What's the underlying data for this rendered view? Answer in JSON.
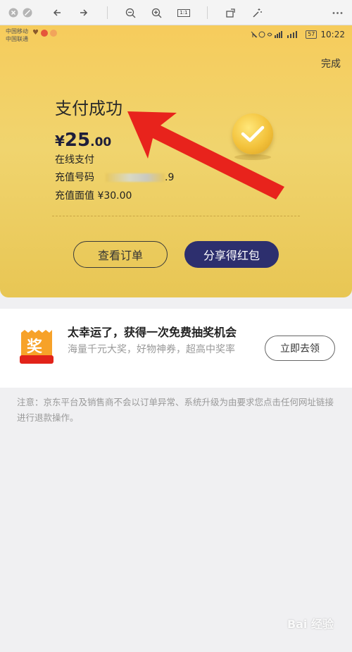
{
  "viewer": {
    "tools": [
      "close-icon",
      "stop-icon",
      "back-icon",
      "forward-icon",
      "zoom-out-icon",
      "zoom-in-icon",
      "actual-size-icon",
      "rotate-icon",
      "magic-icon",
      "more-icon"
    ],
    "actual_size_label": "1:1"
  },
  "status_bar": {
    "carrier1": "中国移动",
    "carrier2": "中国联通",
    "battery": "57",
    "time": "10:22"
  },
  "header": {
    "done_label": "完成"
  },
  "payment": {
    "title": "支付成功",
    "currency": "¥",
    "amount_int": "25",
    "amount_dec": ".00",
    "method": "在线支付",
    "recharge_number_label": "充值号码",
    "recharge_number_suffix": ".9",
    "face_value_label": "充值面值 ¥30.00"
  },
  "actions": {
    "view_order": "查看订单",
    "share": "分享得红包"
  },
  "lottery": {
    "icon_char": "奖",
    "title": "太幸运了，获得一次免费抽奖机会",
    "desc": "海量千元大奖，好物神券，超高中奖率",
    "button": "立即去领"
  },
  "notice": "注意：京东平台及销售商不会以订单异常、系统升级为由要求您点击任何网址链接进行退款操作。",
  "watermark": "Bai 经验",
  "colors": {
    "gold": "#f0d46e",
    "navy": "#2d2f6e",
    "arrow_red": "#e8231c"
  }
}
